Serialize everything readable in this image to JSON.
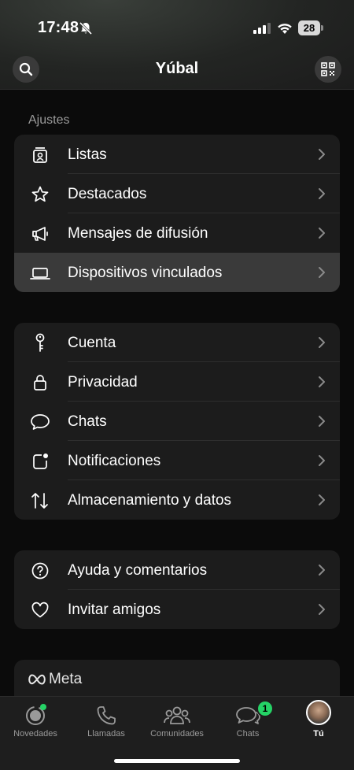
{
  "status": {
    "time": "17:48",
    "battery": "28"
  },
  "header": {
    "title": "Yúbal"
  },
  "settings_label": "Ajustes",
  "group1": [
    {
      "label": "Listas",
      "icon": "list-icon"
    },
    {
      "label": "Destacados",
      "icon": "star-icon"
    },
    {
      "label": "Mensajes de difusión",
      "icon": "megaphone-icon"
    },
    {
      "label": "Dispositivos vinculados",
      "icon": "laptop-icon"
    }
  ],
  "group2": [
    {
      "label": "Cuenta",
      "icon": "key-icon"
    },
    {
      "label": "Privacidad",
      "icon": "lock-icon"
    },
    {
      "label": "Chats",
      "icon": "chat-bubble-icon"
    },
    {
      "label": "Notificaciones",
      "icon": "notification-icon"
    },
    {
      "label": "Almacenamiento y datos",
      "icon": "arrows-updown-icon"
    }
  ],
  "group3": [
    {
      "label": "Ayuda y comentarios",
      "icon": "help-icon"
    },
    {
      "label": "Invitar amigos",
      "icon": "heart-icon"
    }
  ],
  "meta": {
    "label": "Meta"
  },
  "tabs": [
    {
      "label": "Novedades"
    },
    {
      "label": "Llamadas"
    },
    {
      "label": "Comunidades"
    },
    {
      "label": "Chats",
      "badge": "1"
    },
    {
      "label": "Tú"
    }
  ],
  "colors": {
    "accent_green": "#25d366",
    "row_bg": "#1c1c1c",
    "active_row_bg": "#3a3a3a"
  }
}
